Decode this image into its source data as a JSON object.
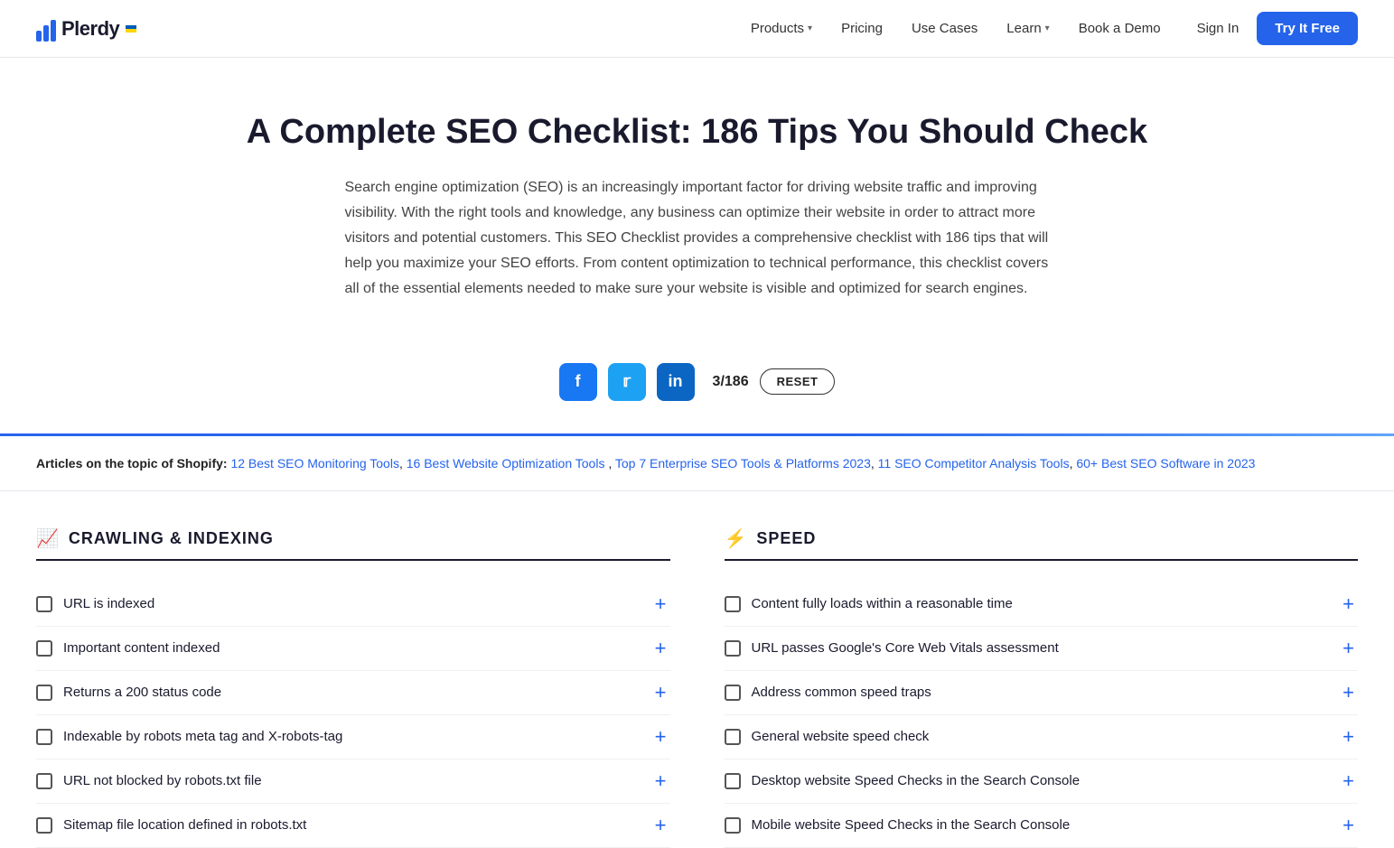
{
  "nav": {
    "logo_text": "Plerdy",
    "items": [
      {
        "label": "Products",
        "has_dropdown": true
      },
      {
        "label": "Pricing",
        "has_dropdown": false
      },
      {
        "label": "Use Cases",
        "has_dropdown": false
      },
      {
        "label": "Learn",
        "has_dropdown": true
      },
      {
        "label": "Book a Demo",
        "has_dropdown": false
      }
    ],
    "sign_in": "Sign In",
    "try_free": "Try It Free"
  },
  "hero": {
    "title": "A Complete SEO Checklist: 186 Tips You Should Check",
    "description": "Search engine optimization (SEO) is an increasingly important factor for driving website traffic and improving visibility. With the right tools and knowledge, any business can optimize their website in order to attract more visitors and potential customers. This SEO Checklist provides a comprehensive checklist with 186 tips that will help you maximize your SEO efforts. From content optimization to technical performance, this checklist covers all of the essential elements needed to make sure your website is visible and optimized for search engines."
  },
  "social": {
    "counter": "3/186",
    "reset_label": "RESET"
  },
  "articles": {
    "prefix": "Articles on the topic of Shopify:",
    "links": [
      "12 Best SEO Monitoring Tools",
      "16 Best Website Optimization Tools",
      "Top 7 Enterprise SEO Tools & Platforms 2023",
      "11 SEO Competitor Analysis Tools",
      "60+ Best SEO Software in 2023"
    ]
  },
  "sections": {
    "left": {
      "icon": "📈",
      "title": "CRAWLING & INDEXING",
      "items": [
        "URL is indexed",
        "Important content indexed",
        "Returns a 200 status code",
        "Indexable by robots meta tag and X-robots-tag",
        "URL not blocked by robots.txt file",
        "Sitemap file location defined in robots.txt"
      ]
    },
    "right": {
      "icon": "⚡",
      "title": "SPEED",
      "items": [
        "Content fully loads within a reasonable time",
        "URL passes Google's Core Web Vitals assessment",
        "Address common speed traps",
        "General website speed check",
        "Desktop website Speed Checks in the Search Console",
        "Mobile website Speed Checks in the Search Console"
      ]
    }
  }
}
